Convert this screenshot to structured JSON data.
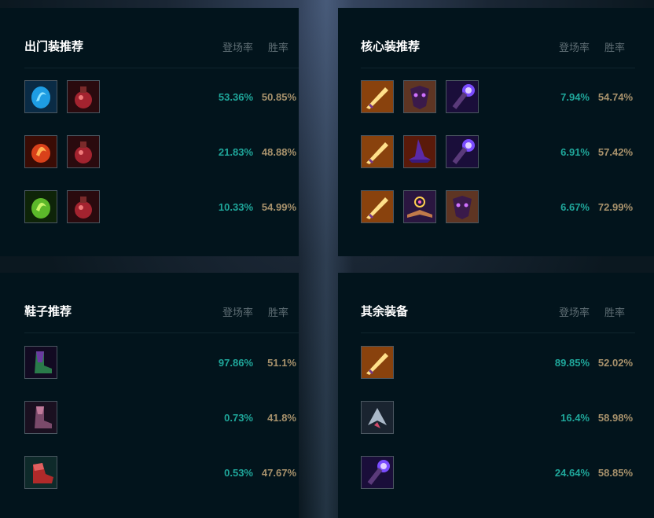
{
  "panels": {
    "starter": {
      "title": "出门装推荐",
      "col_pick": "登场率",
      "col_win": "胜率",
      "rows": [
        {
          "icons": [
            "blue-spirit-seed-icon",
            "potion-icon"
          ],
          "pick": "53.36%",
          "win": "50.85%"
        },
        {
          "icons": [
            "red-spirit-seed-icon",
            "potion-icon"
          ],
          "pick": "21.83%",
          "win": "48.88%"
        },
        {
          "icons": [
            "green-spirit-seed-icon",
            "potion-icon"
          ],
          "pick": "10.33%",
          "win": "54.99%"
        }
      ]
    },
    "core": {
      "title": "核心装推荐",
      "col_pick": "登场率",
      "col_win": "胜率",
      "rows": [
        {
          "icons": [
            "golden-sword-icon",
            "dark-mask-icon",
            "void-staff-icon"
          ],
          "pick": "7.94%",
          "win": "54.74%"
        },
        {
          "icons": [
            "golden-sword-icon",
            "witch-hat-icon",
            "void-staff-icon"
          ],
          "pick": "6.91%",
          "win": "57.42%"
        },
        {
          "icons": [
            "golden-sword-icon",
            "spellbook-icon",
            "dark-mask-icon"
          ],
          "pick": "6.67%",
          "win": "72.99%"
        }
      ]
    },
    "boots": {
      "title": "鞋子推荐",
      "col_pick": "登场率",
      "col_win": "胜率",
      "rows": [
        {
          "icons": [
            "green-boots-icon"
          ],
          "pick": "97.86%",
          "win": "51.1%"
        },
        {
          "icons": [
            "purple-boots-icon"
          ],
          "pick": "0.73%",
          "win": "41.8%"
        },
        {
          "icons": [
            "red-boots-icon"
          ],
          "pick": "0.53%",
          "win": "47.67%"
        }
      ]
    },
    "other": {
      "title": "其余装备",
      "col_pick": "登场率",
      "col_win": "胜率",
      "rows": [
        {
          "icons": [
            "golden-sword-icon"
          ],
          "pick": "89.85%",
          "win": "52.02%"
        },
        {
          "icons": [
            "steel-shard-icon"
          ],
          "pick": "16.4%",
          "win": "58.98%"
        },
        {
          "icons": [
            "void-staff-icon"
          ],
          "pick": "24.64%",
          "win": "58.85%"
        }
      ]
    }
  },
  "colors": {
    "panel_bg": "#02141c",
    "pick_rate": "#1fa79b",
    "win_rate": "#a8926c",
    "header_text": "#5f6e74"
  }
}
